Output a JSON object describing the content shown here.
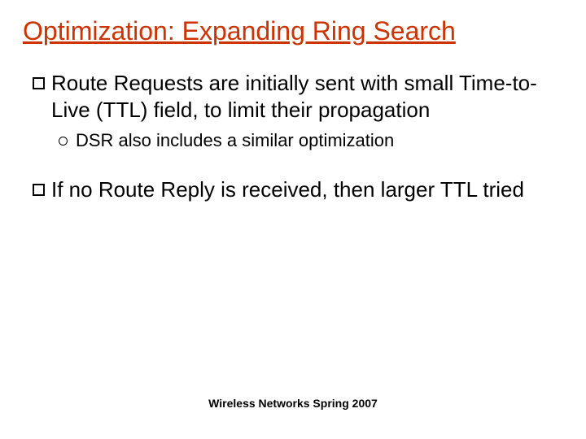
{
  "title": "Optimization: Expanding Ring Search",
  "bullets": {
    "b1": "Route Requests are initially sent with small Time-to-Live (TTL) field, to limit their propagation",
    "b1_sub": "DSR also includes a similar optimization",
    "b2": "If no Route Reply is received, then larger TTL tried"
  },
  "footer": "Wireless Networks Spring 2007"
}
